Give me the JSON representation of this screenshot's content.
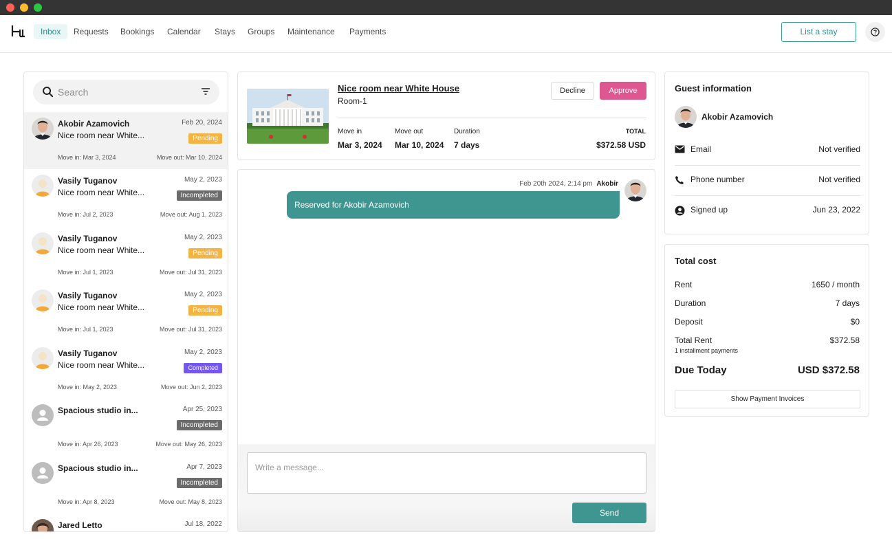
{
  "nav": {
    "items": [
      "Inbox",
      "Requests",
      "Bookings",
      "Calendar",
      "Stays",
      "Groups",
      "Maintenance",
      "Payments"
    ],
    "active": "Inbox",
    "list_stay": "List a stay",
    "help_icon": "help-circle-icon"
  },
  "search": {
    "placeholder": "Search"
  },
  "conversations": [
    {
      "name": "Akobir Azamovich",
      "date": "Feb 20, 2024",
      "preview": "Nice room near White...",
      "status": "Pending",
      "move_in": "Move in: Mar 3, 2024",
      "move_out": "Move out: Mar 10, 2024"
    },
    {
      "name": "Vasily Tuganov",
      "date": "May 2, 2023",
      "preview": "Nice room near White...",
      "status": "Incompleted",
      "move_in": "Move in: Jul 2, 2023",
      "move_out": "Move out: Aug 1, 2023"
    },
    {
      "name": "Vasily Tuganov",
      "date": "May 2, 2023",
      "preview": "Nice room near White...",
      "status": "Pending",
      "move_in": "Move in: Jul 1, 2023",
      "move_out": "Move out: Jul 31, 2023"
    },
    {
      "name": "Vasily Tuganov",
      "date": "May 2, 2023",
      "preview": "Nice room near White...",
      "status": "Pending",
      "move_in": "Move in: Jul 1, 2023",
      "move_out": "Move out: Jul 31, 2023"
    },
    {
      "name": "Vasily Tuganov",
      "date": "May 2, 2023",
      "preview": "Nice room near White...",
      "status": "Completed",
      "move_in": "Move in: May 2, 2023",
      "move_out": "Move out: Jun 2, 2023"
    },
    {
      "name": "Spacious studio in...",
      "date": "Apr 25, 2023",
      "preview": "",
      "status": "Incompleted",
      "move_in": "Move in: Apr 26, 2023",
      "move_out": "Move out: May 26, 2023"
    },
    {
      "name": "Spacious studio in...",
      "date": "Apr 7, 2023",
      "preview": "",
      "status": "Incompleted",
      "move_in": "Move in: Apr 8, 2023",
      "move_out": "Move out: May 8, 2023"
    },
    {
      "name": "Jared Letto",
      "date": "Jul 18, 2022",
      "preview": "",
      "status": "",
      "move_in": "",
      "move_out": ""
    }
  ],
  "booking": {
    "title": "Nice room near White House",
    "room": "Room-1",
    "decline": "Decline",
    "approve": "Approve",
    "move_in_label": "Move in",
    "move_in": "Mar 3, 2024",
    "move_out_label": "Move out",
    "move_out": "Mar 10, 2024",
    "duration_label": "Duration",
    "duration": "7 days",
    "total_label": "TOTAL",
    "total": "$372.58 USD"
  },
  "chat": {
    "timestamp": "Feb 20th 2024, 2:14 pm",
    "sender": "Akobir",
    "message": "Reserved for Akobir Azamovich",
    "placeholder": "Write a message...",
    "send": "Send"
  },
  "guest": {
    "title": "Guest information",
    "name": "Akobir Azamovich",
    "rows": [
      {
        "label": "Email",
        "value": "Not verified",
        "icon": "mail-icon"
      },
      {
        "label": "Phone number",
        "value": "Not verified",
        "icon": "phone-icon"
      },
      {
        "label": "Signed up",
        "value": "Jun 23, 2022",
        "icon": "user-circle-icon"
      }
    ]
  },
  "cost": {
    "title": "Total cost",
    "rent_label": "Rent",
    "rent": "1650 / month",
    "duration_label": "Duration",
    "duration": "7 days",
    "deposit_label": "Deposit",
    "deposit": "$0",
    "total_rent_label": "Total Rent",
    "total_rent": "$372.58",
    "installments": "1 installment payments",
    "due_label": "Due Today",
    "due": "USD $372.58",
    "invoices": "Show Payment Invoices"
  },
  "colors": {
    "accent": "#3f9691",
    "approve": "#de5790",
    "pending": "#f3b443",
    "incompleted": "#6b6b6b",
    "completed": "#7357f0"
  }
}
